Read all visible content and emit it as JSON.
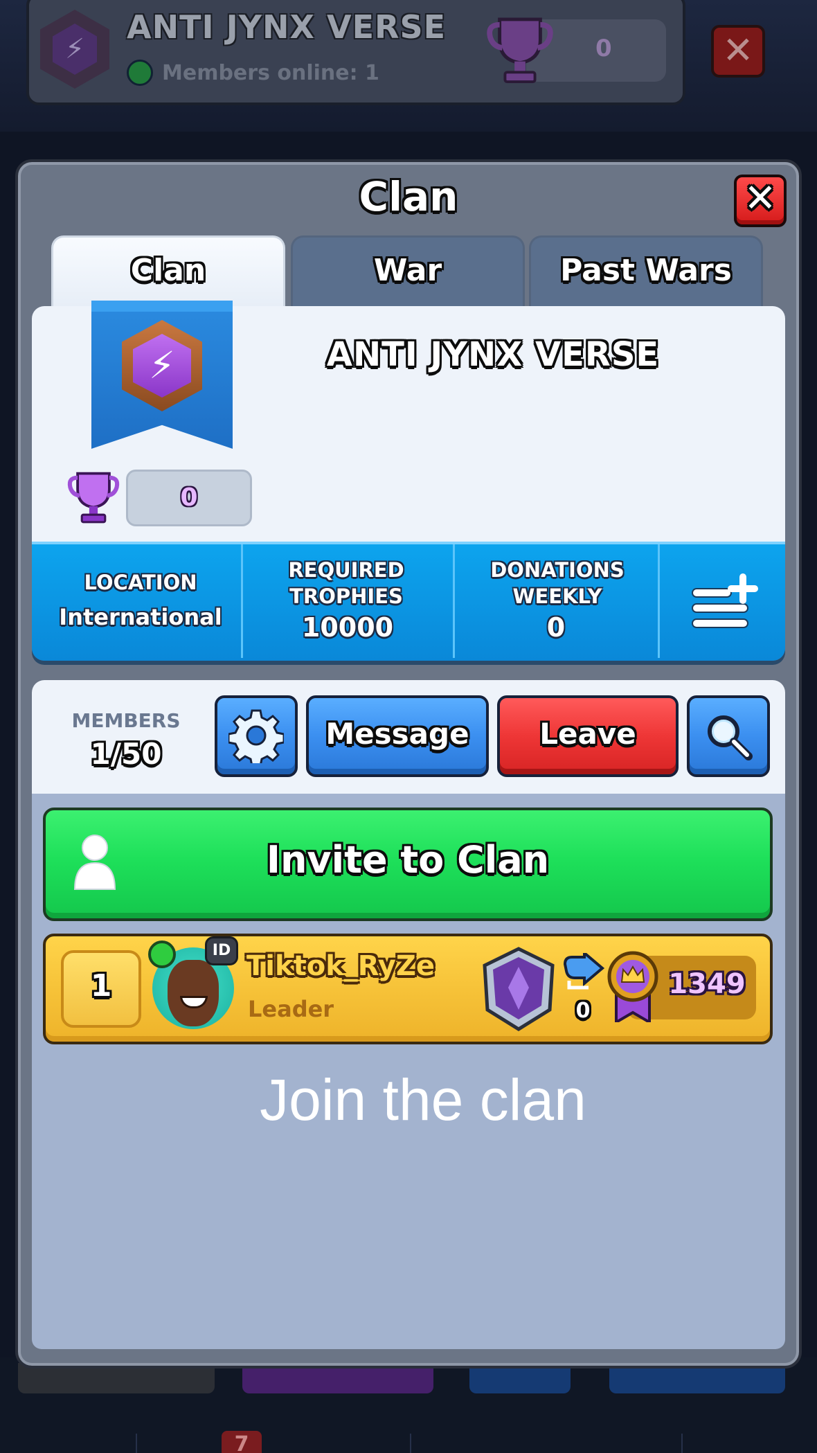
{
  "background_header": {
    "clan_name": "ANTI JYNX VERSE",
    "members_online": "Members online: 1",
    "trophies": "0",
    "close_icon": "close-icon"
  },
  "bottom_bar": {
    "notification_count": "7"
  },
  "modal": {
    "title": "Clan",
    "close_icon": "close-icon",
    "tabs": [
      {
        "label": "Clan",
        "active": true
      },
      {
        "label": "War",
        "active": false
      },
      {
        "label": "Past Wars",
        "active": false
      }
    ]
  },
  "clan": {
    "name": "ANTI JYNX VERSE",
    "trophies": "0",
    "badge_icon": "lightning-badge-icon",
    "stats": [
      {
        "label": "LOCATION",
        "value": "International"
      },
      {
        "label": "REQUIRED TROPHIES",
        "value": "10000"
      },
      {
        "label": "DONATIONS WEEKLY",
        "value": "0"
      }
    ]
  },
  "members_bar": {
    "label": "MEMBERS",
    "count": "1/50",
    "message_label": "Message",
    "leave_label": "Leave"
  },
  "invite": {
    "label": "Invite to Clan"
  },
  "members": [
    {
      "rank": "1",
      "name": "Tiktok_RyZe",
      "role": "Leader",
      "donations": "0",
      "trophies": "1349",
      "online": true,
      "id_badge": "ID"
    }
  ],
  "overlay_caption": "Join the clan",
  "colors": {
    "stats_blue": "#0da4ee",
    "invite_green": "#1ee05a",
    "leave_red": "#ee3636",
    "member_row_gold": "#f7c43a",
    "panel_light": "#eef3fa",
    "list_bg": "#a3b3cf"
  }
}
